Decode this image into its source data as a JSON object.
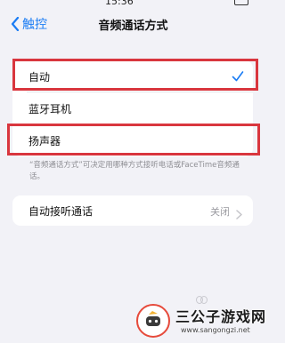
{
  "status_bar": {
    "time": "15:36"
  },
  "nav": {
    "back_label": "触控",
    "title": "音频通话方式"
  },
  "options": [
    {
      "label": "自动",
      "selected": true
    },
    {
      "label": "蓝牙耳机",
      "selected": false
    },
    {
      "label": "扬声器",
      "selected": false
    }
  ],
  "footnote": "“音频通话方式”可决定用哪种方式接听电话或FaceTime音频通话。",
  "auto_answer": {
    "label": "自动接听通话",
    "value": "关闭"
  },
  "watermark": {
    "title": "三公子游戏网",
    "url": "www.sangongzi.net"
  },
  "colors": {
    "accent": "#1a7cf4",
    "highlight_box": "#d9363e",
    "background": "#f2f2f7"
  }
}
